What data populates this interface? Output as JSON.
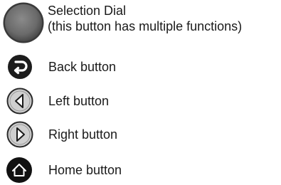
{
  "legend": {
    "items": [
      {
        "id": "selection-dial",
        "icon": "selection-dial-icon",
        "label": "Selection Dial",
        "sublabel": "(this button has multiple functions)"
      },
      {
        "id": "back-button",
        "icon": "back-arrow-icon",
        "label": "Back button"
      },
      {
        "id": "left-button",
        "icon": "left-triangle-icon",
        "label": "Left button"
      },
      {
        "id": "right-button",
        "icon": "right-triangle-icon",
        "label": "Right button"
      },
      {
        "id": "home-button",
        "icon": "home-icon",
        "label": "Home button"
      }
    ]
  },
  "colors": {
    "dial_fill": "#707070",
    "dial_rim": "#3a3a3a",
    "back_fill": "#1c1c1c",
    "arrow_button_fill": "#c8c8c8",
    "arrow_button_ring": "#2a2a2a",
    "home_fill": "#111111",
    "text": "#1a1a1a"
  }
}
